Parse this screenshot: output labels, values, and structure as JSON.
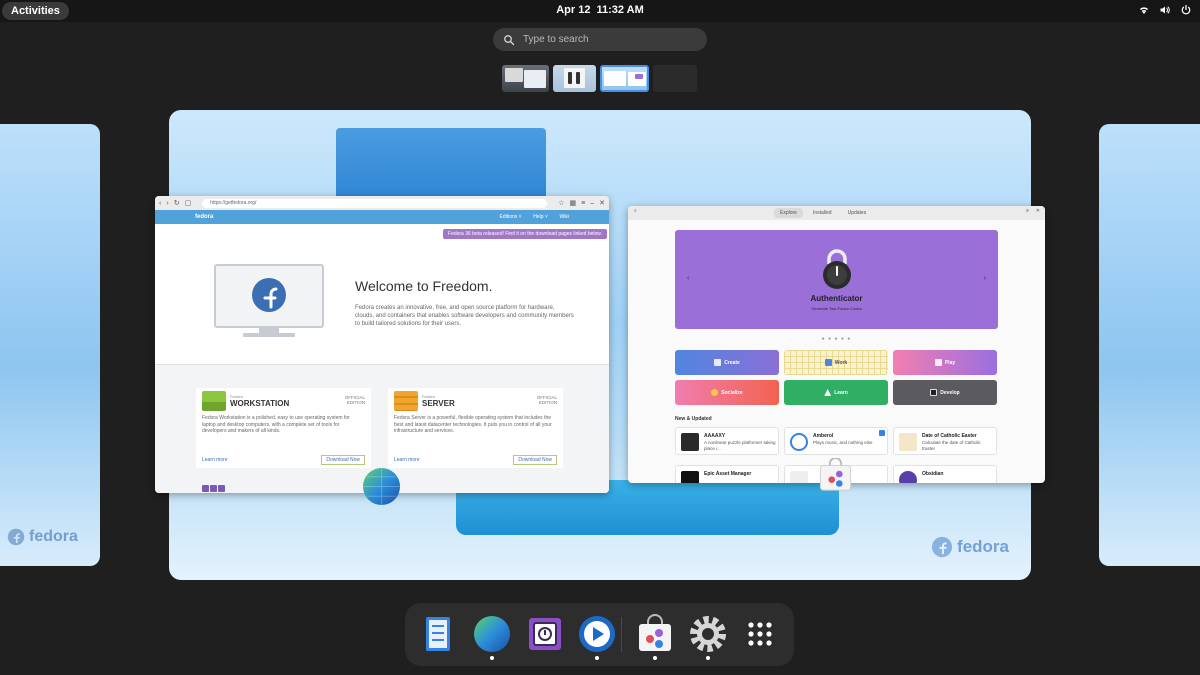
{
  "topbar": {
    "activities_label": "Activities",
    "date": "Apr 12",
    "time": "11:32 AM",
    "tray_icons": [
      "wifi-icon",
      "volume-icon",
      "power-icon"
    ]
  },
  "search": {
    "placeholder": "Type to search"
  },
  "workspaces": {
    "count": 4,
    "active_index": 3
  },
  "browser": {
    "url": "https://getfedora.org/",
    "brand": "fedora",
    "nav_links": [
      "Editions ˅",
      "Help ˅",
      "Wiki"
    ],
    "banner": "Fedora 36 beta released! Find it on the download pages linked below.",
    "hero_title": "Welcome to Freedom.",
    "hero_text": "Fedora creates an innovative, free, and open source platform for hardware, clouds, and containers that enables software developers and community members to build tailored solutions for their users.",
    "editions": [
      {
        "pre": "Fedora",
        "name": "WORKSTATION",
        "official": "OFFICIAL EDITION",
        "desc": "Fedora Workstation is a polished, easy to use operating system for laptop and desktop computers, with a complete set of tools for developers and makers of all kinds.",
        "learn": "Learn more",
        "download": "Download Now"
      },
      {
        "pre": "Fedora",
        "name": "SERVER",
        "official": "OFFICIAL EDITION",
        "desc": "Fedora Server is a powerful, flexible operating system that includes the best and latest datacenter technologies. It puts you in control of all your infrastructure and services.",
        "learn": "Learn more",
        "download": "Download Now"
      }
    ]
  },
  "software": {
    "tabs": [
      "Explore",
      "Installed",
      "Updates"
    ],
    "featured": {
      "title": "Authenticator",
      "subtitle": "Generate Two-Factor Codes"
    },
    "carousel_dots": "● ● ● ● ●",
    "categories": [
      "Create",
      "Work",
      "Play",
      "Socialize",
      "Learn",
      "Develop"
    ],
    "section_title": "New & Updated",
    "apps": [
      {
        "name": "AAAAXY",
        "desc": "A nonlinear puzzle platformer taking place i..."
      },
      {
        "name": "Amberol",
        "desc": "Plays music, and nothing else"
      },
      {
        "name": "Date of Catholic Easter",
        "desc": "Calculate the date of Catholic Easter"
      },
      {
        "name": "Epic Asset Manager",
        "desc": ""
      },
      {
        "name": "",
        "desc": ""
      },
      {
        "name": "Obsidian",
        "desc": ""
      }
    ]
  },
  "wallpaper_brand": "fedora",
  "dock": {
    "apps": [
      {
        "icon": "files-icon",
        "running": false
      },
      {
        "icon": "browser-globe-icon",
        "running": true
      },
      {
        "icon": "password-safe-icon",
        "running": false
      },
      {
        "icon": "amberol-icon",
        "running": true
      },
      {
        "icon": "software-bag-icon",
        "running": true
      },
      {
        "icon": "settings-gear-icon",
        "running": true
      },
      {
        "icon": "app-grid-icon",
        "running": false
      }
    ]
  },
  "colors": {
    "accent": "#4a8fe6",
    "fedora_blue": "#51a2da",
    "featured_purple": "#9b6fd8"
  }
}
